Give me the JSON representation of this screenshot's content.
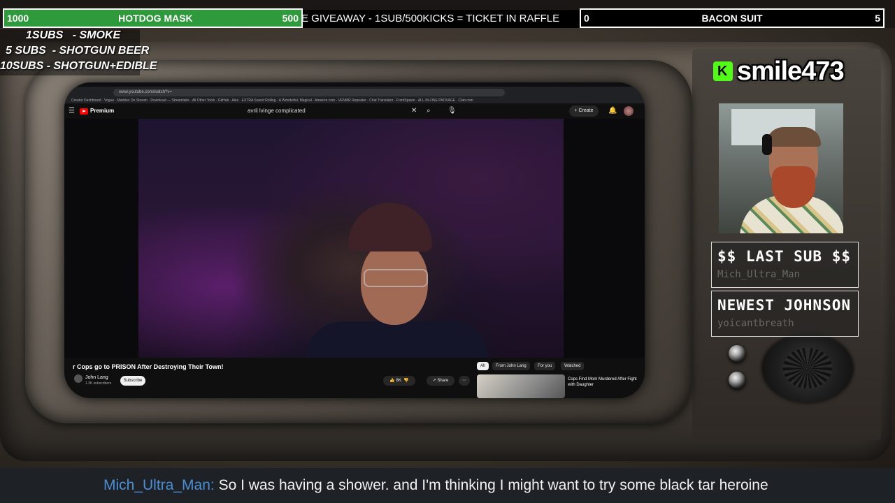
{
  "goals": {
    "left": {
      "current": "1000",
      "title": "HOTDOG MASK",
      "target": "500",
      "color": "#2f9a3b"
    },
    "right": {
      "current": "0",
      "title": "BACON SUIT",
      "target": "5"
    }
  },
  "ticker": "EE GIVEAWAY - 1SUB/500KICKS = TICKET IN RAFFLE",
  "incentives": [
    "1SUBS   - SMOKE",
    "5 SUBS  - SHOTGUN BEER",
    "10SUBS - SHOTGUN+EDIBLE"
  ],
  "streamer": {
    "platform_icon": "kick-logo-icon",
    "name": "smile473",
    "brand_color": "#53fc18"
  },
  "last_sub": {
    "title": "$$ LAST SUB $$",
    "value": "Mich_Ultra_Man"
  },
  "newest": {
    "title": "NEWEST JOHNSON",
    "value": "yoicantbreath"
  },
  "browser": {
    "url": "www.youtube.com/watch?v=",
    "bookmarks": "Creator Dashboard  ·  Vogue  ·  Marbles On Stream  ·  Download — Streamlabs  ·  All Other Tools  ·  GitHub  ·  Alex  ·  EXTRA Sound Rolling  ·  A Wonderful, Magical  ·  Amazon.com  ·  VENMR Repeater  ·  Chat Translator  ·  FrontSpawn  ·  ALL-IN-ONE PACKAGE  ·  Clab.com"
  },
  "youtube": {
    "logo": "Premium",
    "search_query": "avril lvinge complicated",
    "create_label": "Create",
    "video_title": "r Cops go to PRISON After Destroying Their Town!",
    "channel_name": "John Lang",
    "channel_subs": "1.3K subscribers",
    "subscribe_label": "Subscribe",
    "likes": "8K",
    "share_label": "Share",
    "chips": [
      "All",
      "From John Lang",
      "For you",
      "Watched"
    ],
    "rec_title": "Cops Find Mom Murdered After Fight with Daughter"
  },
  "chat": {
    "user": "Mich_Ultra_Man:",
    "message": "So I was having a shower. and I'm thinking I might want to try some black tar heroine"
  }
}
